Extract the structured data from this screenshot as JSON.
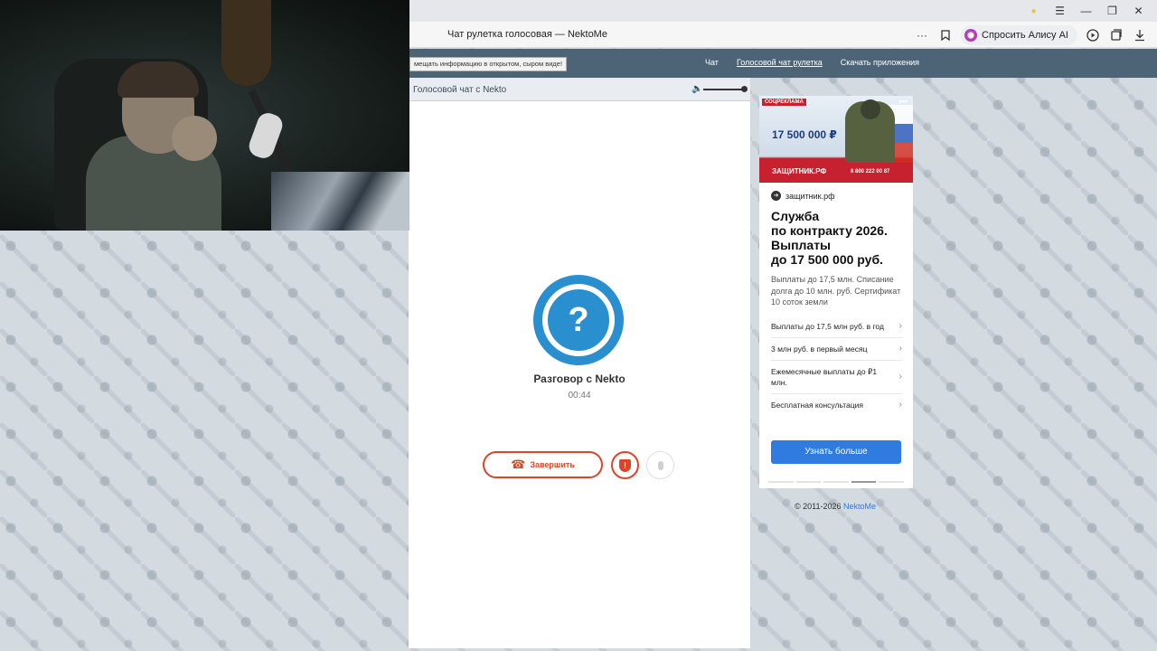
{
  "browser": {
    "tab_title": "Чат рулетка голосовая — NektoMe",
    "more_label": "···",
    "alice_label": "Спросить Алису AI"
  },
  "site": {
    "warning": "мещать информацию в открытом, сыром виде!",
    "nav": [
      "Чат",
      "Голосовой чат рулетка",
      "Скачать приложения"
    ]
  },
  "chat": {
    "header": "Голосовой чат с Nekto",
    "avatar_glyph": "?",
    "title": "Разговор с Nekto",
    "timer": "00:44",
    "end_label": "Завершить"
  },
  "ad": {
    "mark": "СОЦРЕКЛАМА",
    "amount": "17 500 000 ₽",
    "brand": "ЗАЩИТНИК.РФ",
    "phone": "8 800 222 00 87",
    "domain": "защитник.рф",
    "headline_lines": [
      "Служба",
      "по контракту 2026.",
      "Выплаты",
      "до 17 500 000 руб."
    ],
    "description": "Выплаты до 17,5 млн. Списание долга до 10 млн. руб. Сертификат 10 соток земли",
    "items": [
      "Выплаты до 17,5 млн руб. в год",
      "3 млн руб. в первый месяц",
      "Ежемесячные выплаты до ₽1 млн.",
      "Бесплатная консультация"
    ],
    "cta": "Узнать больше"
  },
  "footer": {
    "copyright": "© 2011-2026",
    "link": "NektoMe"
  }
}
